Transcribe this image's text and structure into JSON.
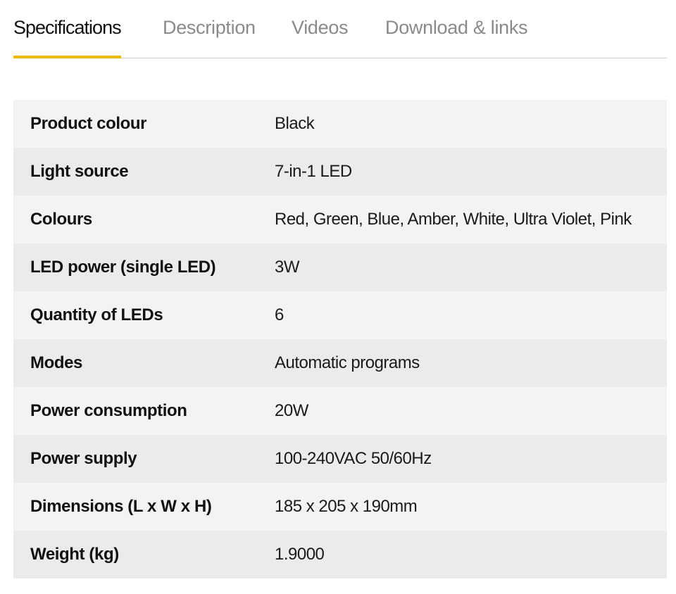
{
  "tabs": [
    {
      "label": "Specifications",
      "active": true
    },
    {
      "label": "Description",
      "active": false
    },
    {
      "label": "Videos",
      "active": false
    },
    {
      "label": "Download & links",
      "active": false
    }
  ],
  "accent_color": "#f2b600",
  "specifications": [
    {
      "label": "Product colour",
      "value": "Black"
    },
    {
      "label": "Light source",
      "value": "7-in-1 LED"
    },
    {
      "label": "Colours",
      "value": "Red, Green, Blue, Amber, White, Ultra Violet, Pink"
    },
    {
      "label": "LED power (single LED)",
      "value": "3W"
    },
    {
      "label": "Quantity of LEDs",
      "value": "6"
    },
    {
      "label": "Modes",
      "value": "Automatic programs"
    },
    {
      "label": "Power consumption",
      "value": "20W"
    },
    {
      "label": "Power supply",
      "value": "100-240VAC 50/60Hz"
    },
    {
      "label": "Dimensions (L x W x H)",
      "value": "185 x 205 x 190mm"
    },
    {
      "label": "Weight (kg)",
      "value": "1.9000"
    }
  ]
}
